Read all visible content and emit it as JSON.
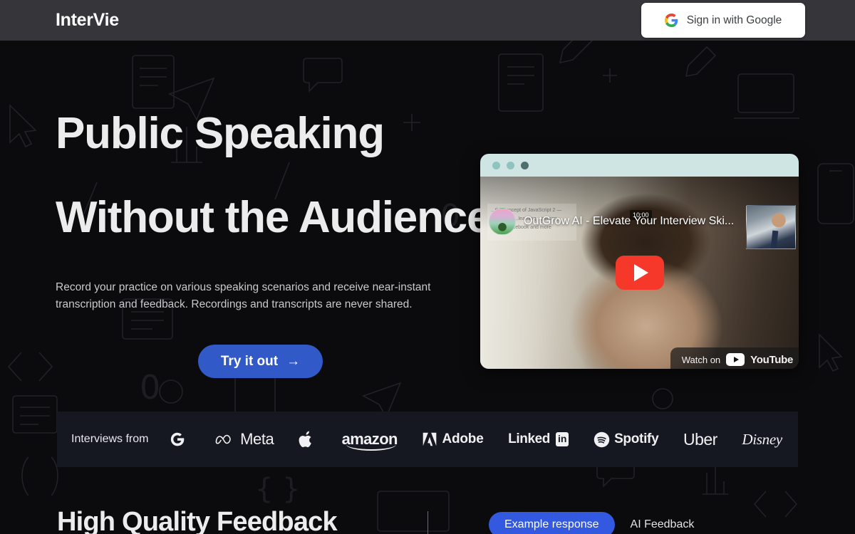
{
  "header": {
    "logo": "InterVie",
    "signin_label": "Sign in with Google",
    "signin_icon": "google-g-icon"
  },
  "hero": {
    "headline_line1": "Public Speaking",
    "headline_line2": "Without the Audience",
    "subtext": "Record your practice on various speaking scenarios and receive near-instant transcription and feedback. Recordings and transcripts are never shared.",
    "cta_label": "Try it out",
    "cta_arrow": "→",
    "cta_color": "#3259c8"
  },
  "video": {
    "title": "OutGrow AI - Elevate Your Interview Ski...",
    "duration": "10:00",
    "watch_on_label": "Watch on",
    "youtube_label": "YouTube",
    "ghost_text": "...the concept of JavaScript 2  — contribute  ...learning  ...person, google, facebook and more",
    "kebab_icon": "more-options-icon",
    "play_icon": "play-button-icon",
    "titlebar_dots": [
      "dot-teal-1",
      "dot-teal-2",
      "dot-dark"
    ]
  },
  "logos": {
    "label": "Interviews from",
    "brands": [
      {
        "name": "Google",
        "display": "",
        "icon": "google-g-icon"
      },
      {
        "name": "Meta",
        "display": "Meta",
        "icon": "meta-infinity-icon"
      },
      {
        "name": "Apple",
        "display": "",
        "icon": "apple-icon"
      },
      {
        "name": "amazon",
        "display": "amazon",
        "icon": "amazon-smile-icon"
      },
      {
        "name": "Adobe",
        "display": "Adobe",
        "icon": "adobe-a-icon"
      },
      {
        "name": "LinkedIn",
        "display": "Linked",
        "badge": "in",
        "icon": "linkedin-icon"
      },
      {
        "name": "Spotify",
        "display": "Spotify",
        "icon": "spotify-icon"
      },
      {
        "name": "Uber",
        "display": "Uber",
        "icon": "uber-wordmark-icon"
      },
      {
        "name": "Disney",
        "display": "Disney",
        "icon": "disney-wordmark-icon"
      }
    ]
  },
  "bottom": {
    "heading": "High Quality Feedback",
    "tab_active": "Example response",
    "tab_idle": "AI Feedback",
    "tab_active_color": "#3259e0"
  }
}
